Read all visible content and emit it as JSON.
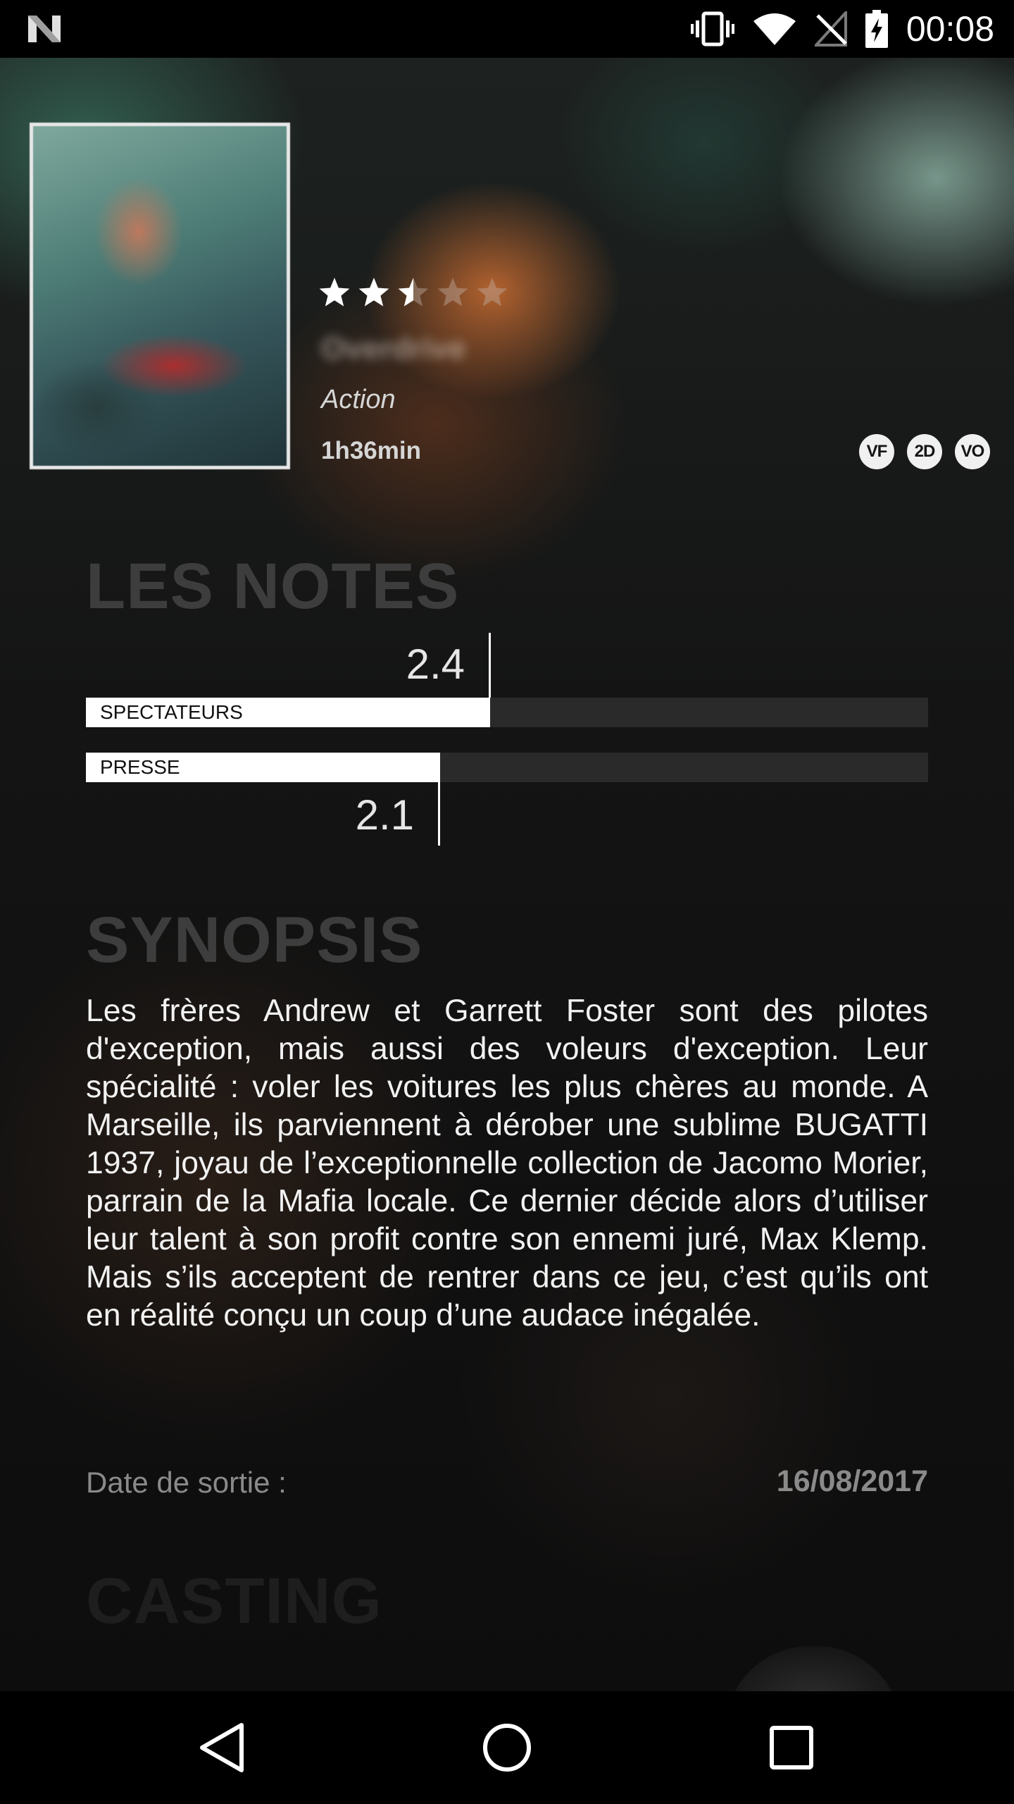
{
  "status_bar": {
    "time": "00:08",
    "icons": [
      "n-logo-icon",
      "vibrate-icon",
      "wifi-icon",
      "no-signal-icon",
      "battery-charging-icon"
    ]
  },
  "movie": {
    "title": "Overdrive",
    "genre": "Action",
    "duration": "1h36min",
    "rating_stars": 2.5,
    "rating_max": 5,
    "versions": [
      "VF",
      "2D",
      "VO"
    ]
  },
  "notes": {
    "heading": "LES NOTES",
    "scale_max": 5,
    "spectateurs": {
      "label": "SPECTATEURS",
      "score": "2.4",
      "value": 2.4
    },
    "presse": {
      "label": "PRESSE",
      "score": "2.1",
      "value": 2.1
    }
  },
  "synopsis": {
    "heading": "SYNOPSIS",
    "text": "Les frères Andrew et Garrett Foster sont des pilotes d'exception, mais aussi des voleurs d'exception. Leur spécialité : voler les voitures les plus chères au monde. A Marseille, ils parviennent à dérober une sublime BUGATTI 1937, joyau de l’exceptionnelle collection de Jacomo Morier, parrain de la Mafia locale.  Ce dernier décide alors d’utiliser leur talent à son profit contre son ennemi juré, Max Klemp. Mais s’ils acceptent de rentrer dans ce jeu, c’est qu’ils ont en réalité conçu un coup d’une audace inégalée."
  },
  "release": {
    "label": "Date de sortie :",
    "date": "16/08/2017"
  },
  "casting": {
    "heading": "CASTING"
  },
  "colors": {
    "bar_fill": "#ffffff",
    "bar_track": "#2a2a2a",
    "heading": "#3d3d3d"
  }
}
